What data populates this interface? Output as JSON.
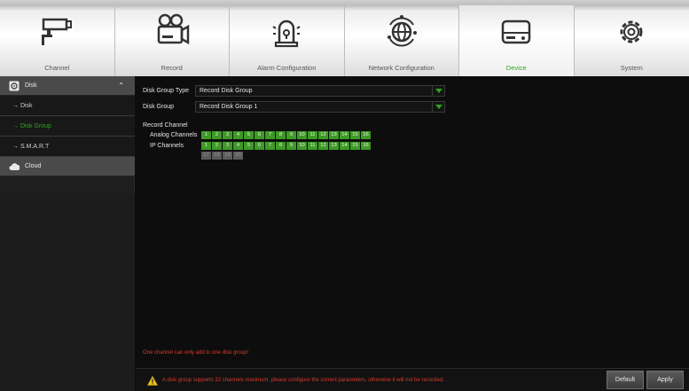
{
  "nav": {
    "tabs": [
      {
        "label": "Channel",
        "icon": "camera-icon",
        "active": false
      },
      {
        "label": "Record",
        "icon": "video-camera-icon",
        "active": false
      },
      {
        "label": "Alarm Configuration",
        "icon": "alarm-light-icon",
        "active": false
      },
      {
        "label": "Network Configuration",
        "icon": "globe-icon",
        "active": false
      },
      {
        "label": "Device",
        "icon": "hard-drive-icon",
        "active": true
      },
      {
        "label": "System",
        "icon": "gear-icon",
        "active": false
      }
    ]
  },
  "sidebar": {
    "disk_header": "Disk",
    "items": [
      {
        "label": "→ Disk",
        "active": false
      },
      {
        "label": "→ Disk Group",
        "active": true
      },
      {
        "label": "→ S.M.A.R.T",
        "active": false
      }
    ],
    "cloud_header": "Cloud"
  },
  "form": {
    "disk_group_type_label": "Disk Group Type",
    "disk_group_type_value": "Record Disk Group",
    "disk_group_label": "Disk Group",
    "disk_group_value": "Record Disk Group 1",
    "record_channel_label": "Record Channel",
    "analog_label": "Analog Channels",
    "ip_label": "IP Channels",
    "analog_channels": [
      "1",
      "2",
      "3",
      "4",
      "5",
      "6",
      "7",
      "8",
      "9",
      "10",
      "11",
      "12",
      "13",
      "14",
      "15",
      "16"
    ],
    "ip_channels_enabled": [
      "1",
      "2",
      "3",
      "4",
      "5",
      "6",
      "7",
      "8",
      "9",
      "10",
      "11",
      "12",
      "13",
      "14",
      "15",
      "16"
    ],
    "ip_channels_disabled": [
      "17",
      "18",
      "19",
      "20"
    ]
  },
  "note": "One channel can only add to one disk group!",
  "warning": "A disk group supports 32 channels maximum, please configure the correct parameters, otherwise it will not be recorded.",
  "buttons": {
    "default": "Default",
    "apply": "Apply"
  },
  "colors": {
    "accent": "#2ea61f",
    "channel_on": "#3e9a27",
    "channel_off": "#5a5a5a",
    "warning_text": "#d83a2a"
  }
}
